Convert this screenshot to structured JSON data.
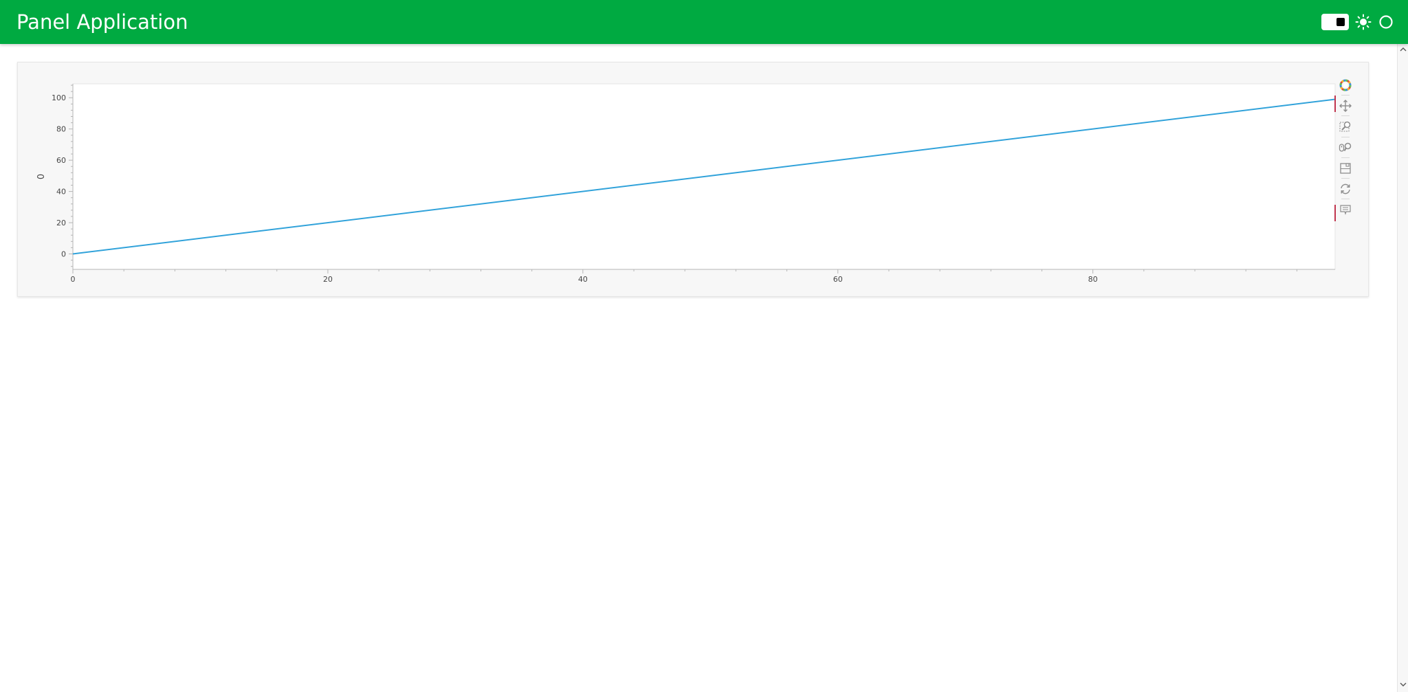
{
  "header": {
    "title": "Panel Application",
    "bg_color": "#00aa41",
    "icons": [
      "theme-toggle",
      "sun-icon",
      "circle-status-icon"
    ]
  },
  "toolbar": {
    "tools": [
      "bokeh-logo-icon",
      "pan-icon",
      "box-zoom-icon",
      "wheel-zoom-icon",
      "save-icon",
      "reset-icon",
      "hover-icon"
    ]
  },
  "chart_data": {
    "type": "line",
    "title": "",
    "xlabel": "",
    "ylabel": "0",
    "x": [
      0,
      99
    ],
    "series": [
      {
        "values": [
          0,
          99
        ],
        "color": "#30a2da"
      }
    ],
    "xlim": [
      0,
      99
    ],
    "ylim": [
      -9.9,
      108.9
    ],
    "xticks": [
      0,
      20,
      40,
      60,
      80
    ],
    "yticks": [
      0,
      20,
      40,
      60,
      80,
      100
    ],
    "grid": false,
    "legend": "none"
  }
}
